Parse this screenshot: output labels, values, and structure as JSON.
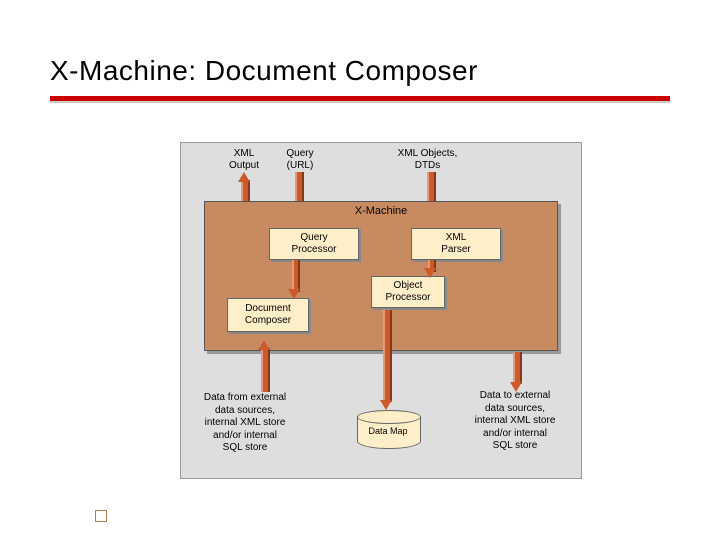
{
  "title": "X-Machine: Document Composer",
  "top_labels": {
    "xml_output_l1": "XML",
    "xml_output_l2": "Output",
    "query_l1": "Query",
    "query_l2": "(URL)",
    "xml_objects_l1": "XML Objects,",
    "xml_objects_l2": "DTDs"
  },
  "xmachine": {
    "label": "X-Machine",
    "query_processor_l1": "Query",
    "query_processor_l2": "Processor",
    "xml_parser_l1": "XML",
    "xml_parser_l2": "Parser",
    "document_composer_l1": "Document",
    "document_composer_l2": "Composer",
    "object_processor_l1": "Object",
    "object_processor_l2": "Processor"
  },
  "datamap": "Data Map",
  "bottom_text": {
    "left_l1": "Data from external",
    "left_l2": "data sources,",
    "left_l3": "internal XML store",
    "left_l4": "and/or internal",
    "left_l5": "SQL store",
    "right_l1": "Data to external",
    "right_l2": "data sources,",
    "right_l3": "internal XML store",
    "right_l4": "and/or internal",
    "right_l5": "SQL store"
  },
  "colors": {
    "accent_red": "#cc0000",
    "box_fill": "#c88b61",
    "sub_fill": "#ffefc8"
  }
}
